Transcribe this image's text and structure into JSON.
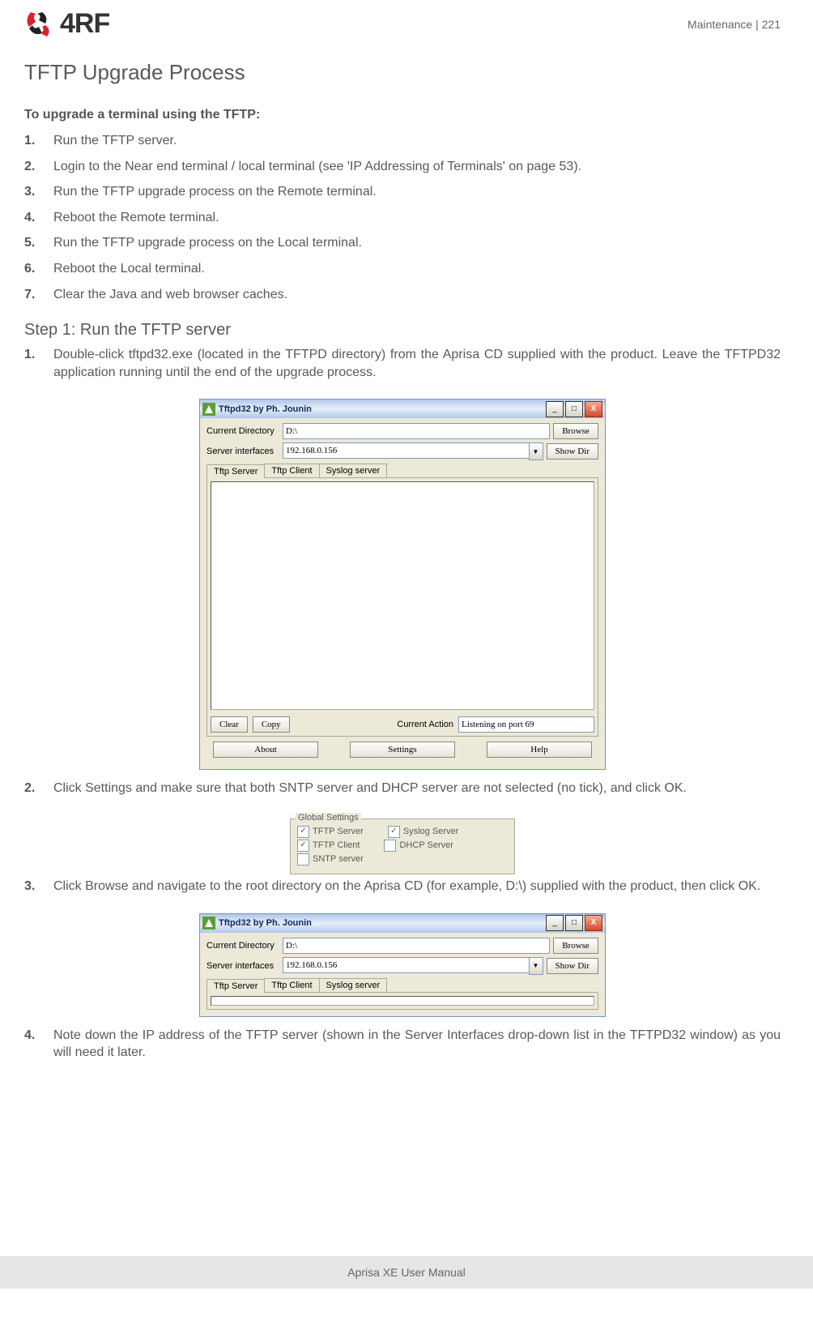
{
  "header": {
    "brand": "4RF",
    "right": "Maintenance  |  221"
  },
  "title": "TFTP Upgrade Process",
  "intro": "To upgrade a terminal using the TFTP:",
  "overview_steps": [
    "Run the TFTP server.",
    "Login to the Near end terminal / local terminal (see 'IP Addressing of Terminals' on page 53).",
    "Run the TFTP upgrade process on the Remote terminal.",
    "Reboot the Remote terminal.",
    "Run the TFTP upgrade process on the Local terminal.",
    "Reboot the Local terminal.",
    "Clear the Java and web browser caches."
  ],
  "step1_title": "Step 1: Run the TFTP server",
  "step1_items": [
    "Double-click tftpd32.exe (located in the TFTPD directory) from the Aprisa CD supplied with the product. Leave the TFTPD32 application running until the end of the upgrade process.",
    "Click Settings and make sure that both SNTP server and DHCP server are not selected (no tick), and click OK.",
    "Click Browse and navigate to the root directory on the Aprisa CD (for example, D:\\) supplied with the product, then click OK.",
    "Note down the IP address of the TFTP server (shown in the Server Interfaces drop-down list in the TFTPD32 window) as you will need it later."
  ],
  "win": {
    "title": "Tftpd32 by Ph. Jounin",
    "curdir_label": "Current Directory",
    "curdir_value": "D:\\",
    "browse": "Browse",
    "srvif_label": "Server interfaces",
    "srvif_value": "192.168.0.156",
    "showdir": "Show Dir",
    "tabs": [
      "Tftp Server",
      "Tftp Client",
      "Syslog server"
    ],
    "clear": "Clear",
    "copy": "Copy",
    "curact_label": "Current Action",
    "curact_value": "Listening on port 69",
    "about": "About",
    "settings": "Settings",
    "help": "Help"
  },
  "global": {
    "legend": "Global Settings",
    "tftp_server": "TFTP Server",
    "syslog_server": "Syslog Server",
    "tftp_client": "TFTP Client",
    "dhcp_server": "DHCP Server",
    "sntp_server": "SNTP server"
  },
  "footer": "Aprisa XE User Manual"
}
